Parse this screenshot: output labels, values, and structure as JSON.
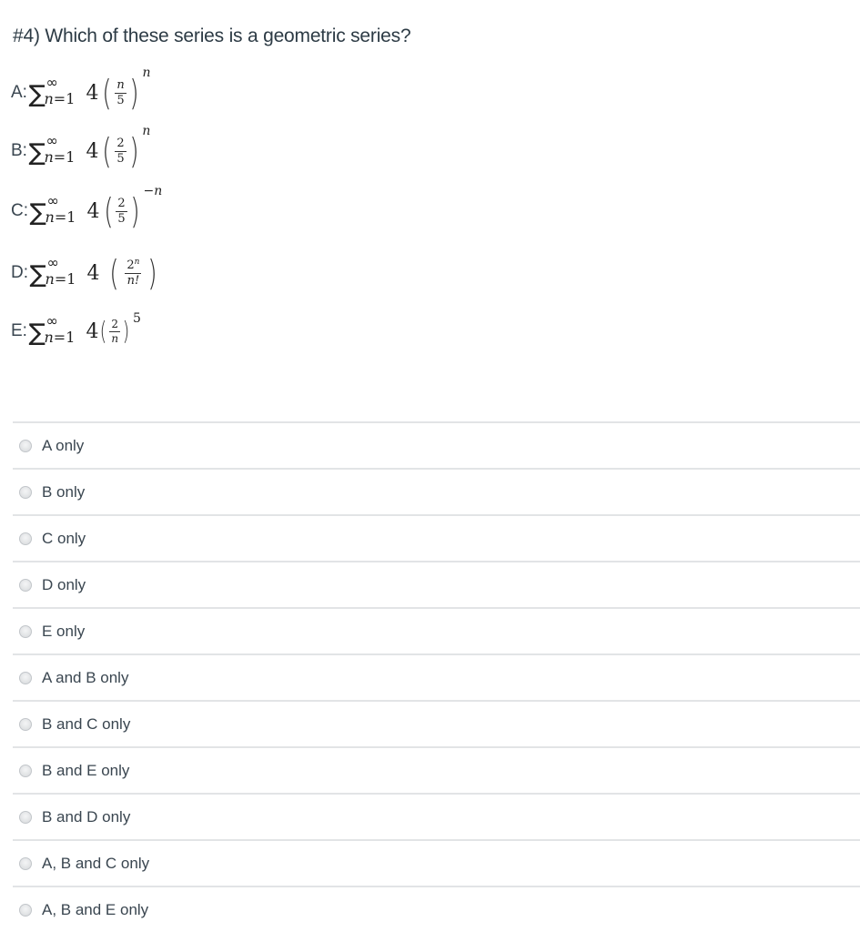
{
  "question": {
    "text": "#4) Which of these series is a geometric series?"
  },
  "series": [
    {
      "label": "A:",
      "sum_upper": "∞",
      "sum_lower_var": "n",
      "sum_lower_rest": "=1",
      "coef": "4",
      "num": "n",
      "den": "5",
      "exponent": "n"
    },
    {
      "label": "B:",
      "sum_upper": "∞",
      "sum_lower_var": "n",
      "sum_lower_rest": "=1",
      "coef": "4",
      "num": "2",
      "den": "5",
      "exponent": "n"
    },
    {
      "label": "C:",
      "sum_upper": "∞",
      "sum_lower_var": "n",
      "sum_lower_rest": "=1",
      "coef": "4",
      "num": "2",
      "den": "5",
      "exponent_sign": "−",
      "exponent": "n"
    },
    {
      "label": "D:",
      "sum_upper": "∞",
      "sum_lower_var": "n",
      "sum_lower_rest": "=1",
      "coef": "4",
      "num_base": "2",
      "num_sup": "n",
      "den": "n!"
    },
    {
      "label": "E:",
      "sum_upper": "∞",
      "sum_lower_var": "n",
      "sum_lower_rest": "=1",
      "coef": "4",
      "num": "2",
      "den": "n",
      "exponent": "5"
    }
  ],
  "options": [
    {
      "label": "A only",
      "selected": false
    },
    {
      "label": "B only",
      "selected": false
    },
    {
      "label": "C only",
      "selected": false
    },
    {
      "label": "D only",
      "selected": false
    },
    {
      "label": "E only",
      "selected": false
    },
    {
      "label": "A and B only",
      "selected": false
    },
    {
      "label": "B and C only",
      "selected": false
    },
    {
      "label": "B and E only",
      "selected": false
    },
    {
      "label": "B and D only",
      "selected": false
    },
    {
      "label": "A, B and C only",
      "selected": false
    },
    {
      "label": "A, B and E only",
      "selected": false
    }
  ],
  "icons": {
    "sigma": "∑",
    "radio": "radio-unchecked-icon"
  }
}
